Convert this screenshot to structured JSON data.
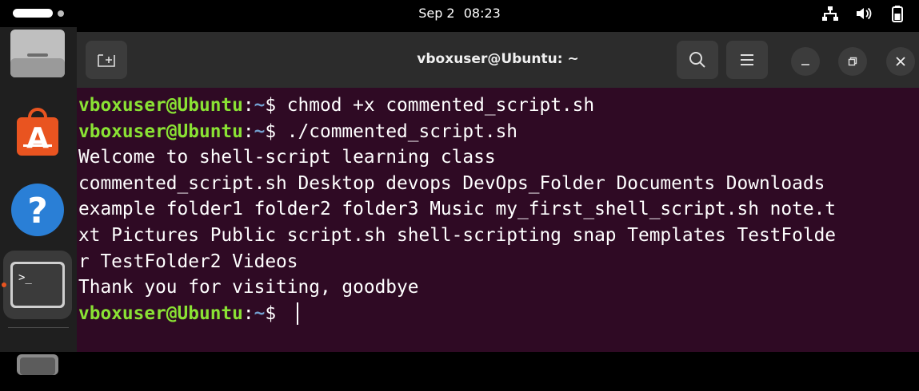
{
  "topbar": {
    "date": "Sep 2",
    "time": "08:23",
    "icons": [
      "network-icon",
      "volume-icon",
      "battery-icon"
    ]
  },
  "dock": {
    "items": [
      "files-icon",
      "app-center-icon",
      "help-icon",
      "terminal-icon",
      "app-icon"
    ]
  },
  "window": {
    "title": "vboxuser@Ubuntu: ~",
    "buttons": [
      "new-tab-icon",
      "search-icon",
      "menu-icon",
      "minimize-icon",
      "restore-icon",
      "close-icon"
    ]
  },
  "terminal": {
    "user_host": "vboxuser@Ubuntu",
    "colon": ":",
    "path": "~",
    "dollar": "$ ",
    "lines": [
      {
        "type": "prompt",
        "cmd": "chmod +x commented_script.sh"
      },
      {
        "type": "prompt",
        "cmd": "./commented_script.sh"
      },
      {
        "type": "output",
        "text": "Welcome to shell-script learning class"
      },
      {
        "type": "output",
        "text": "commented_script.sh Desktop devops DevOps_Folder Documents Downloads"
      },
      {
        "type": "output",
        "text": "example folder1 folder2 folder3 Music my_first_shell_script.sh note.t"
      },
      {
        "type": "output",
        "text": "xt Pictures Public script.sh shell-scripting snap Templates TestFolde"
      },
      {
        "type": "output",
        "text": "r TestFolder2 Videos"
      },
      {
        "type": "output",
        "text": "Thank you for visiting, goodbye"
      },
      {
        "type": "prompt",
        "cmd": ""
      }
    ]
  },
  "colors": {
    "terminal_bg": "#2f0a24",
    "user_host": "#8ae234",
    "path": "#729fcf",
    "accent": "#e95420"
  }
}
